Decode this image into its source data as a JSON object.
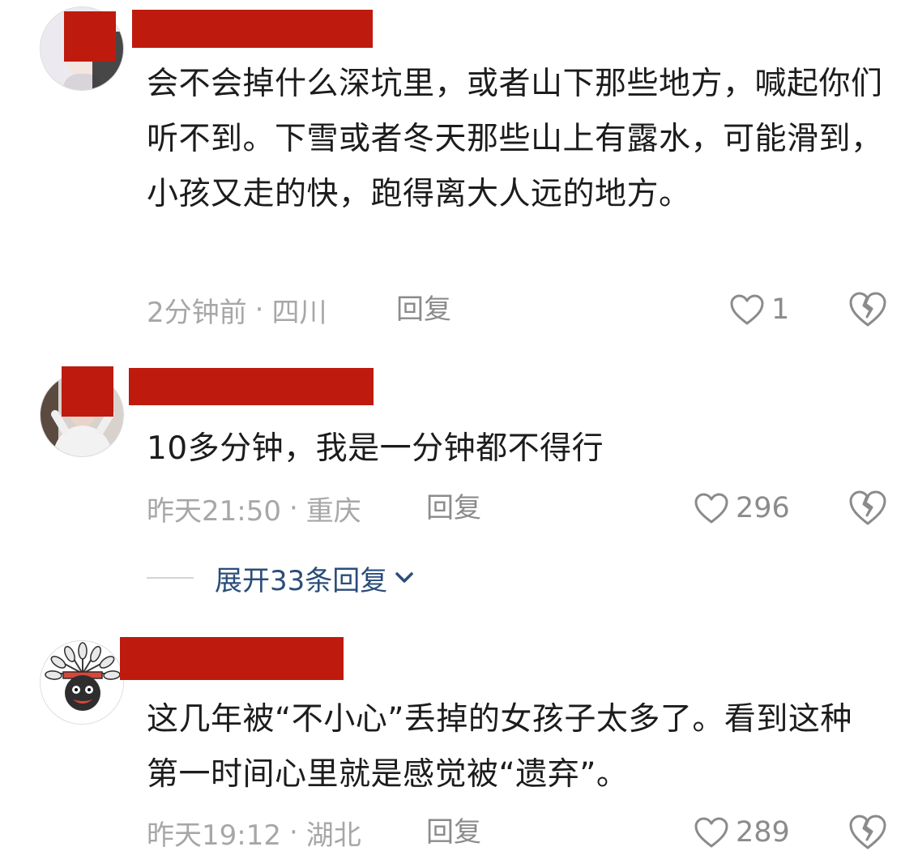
{
  "comments": [
    {
      "text": "会不会掉什么深坑里，或者山下那些地方，喊起你们听不到。下雪或者冬天那些山上有露水，可能滑到，小孩又走的快，跑得离大人远的地方。",
      "time": "2分钟前",
      "location": "四川",
      "reply_label": "回复",
      "likes": "1",
      "avatar_icon": "user-photo-avatar"
    },
    {
      "text": "10多分钟，我是一分钟都不得行",
      "time": "昨天21:50",
      "location": "重庆",
      "reply_label": "回复",
      "likes": "296",
      "avatar_icon": "user-photo-avatar"
    },
    {
      "text": "这几年被“不小心”丢掉的女孩子太多了。看到这种第一时间心里就是感觉被“遗弃”。",
      "time": "昨天19:12",
      "location": "湖北",
      "reply_label": "回复",
      "likes": "289",
      "avatar_icon": "headdress-cartoon-avatar"
    }
  ],
  "expand_replies": {
    "label": "展开33条回复"
  },
  "separator": "·",
  "colors": {
    "redaction": "#be1a0e",
    "expand_link": "#2b4d7a",
    "meta_text": "#a7a7a7",
    "icon_gray": "#8b8b8b"
  }
}
